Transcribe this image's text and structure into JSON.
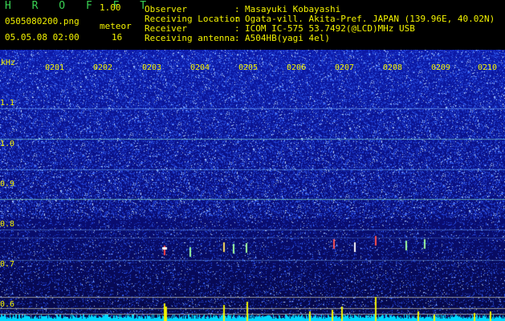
{
  "app": {
    "title": "H R O F F T",
    "version": "1.00"
  },
  "file": {
    "name": "0505080200.png",
    "datetime": "05.05.08 02:00"
  },
  "meteor": {
    "label": "meteor",
    "count": "16"
  },
  "info": [
    {
      "key": "Observer",
      "sep": ":",
      "value": "Masayuki Kobayashi"
    },
    {
      "key": "Receiving Location",
      "sep": ":",
      "value": "Ogata-vill. Akita-Pref. JAPAN (139.96E, 40.02N)"
    },
    {
      "key": "Receiver",
      "sep": ":",
      "value": "ICOM IC-575 53.7492(@LCD)MHz USB"
    },
    {
      "key": "Receiving antenna",
      "sep": ":",
      "value": "A504HB(yagi 4el)"
    }
  ],
  "axis": {
    "unit": "kHz",
    "y_ticks": [
      "1.1",
      "1.0",
      "0.9",
      "0.8",
      "0.7",
      "0.6"
    ],
    "x_ticks": [
      "0201",
      "0202",
      "0203",
      "0204",
      "0205",
      "0206",
      "0207",
      "0208",
      "0209",
      "0210"
    ]
  },
  "colors": {
    "label_green": "#39d353",
    "label_yellow": "#f2f200",
    "background": "#0a0a7a",
    "noise_bright": "#3a6cff",
    "meteor_echo": "#ff3030",
    "baseline": "#00e5ff"
  }
}
